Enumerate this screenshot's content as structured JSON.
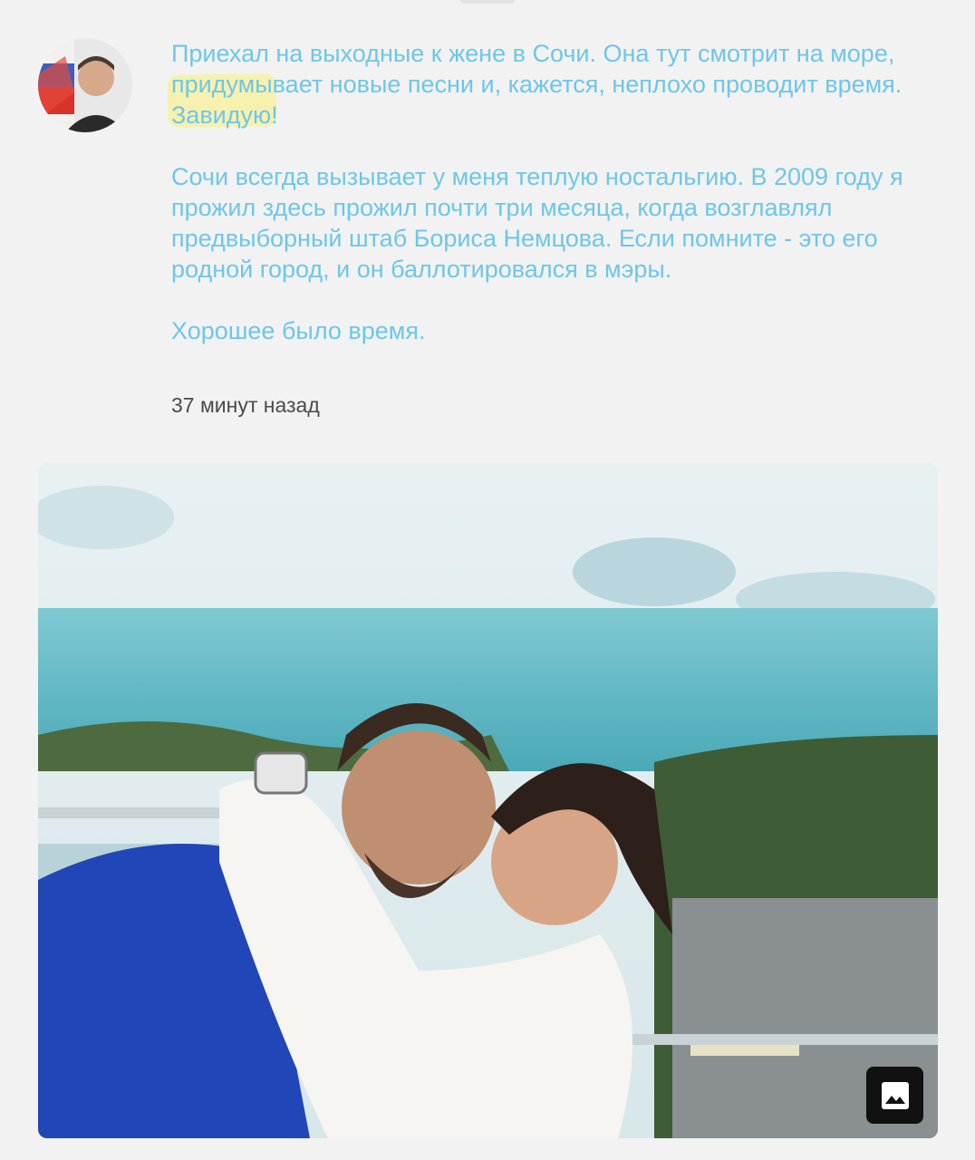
{
  "post": {
    "author_avatar": "avatar-icon",
    "paragraphs": {
      "p1_pre": "Приехал на выходные к жене в Сочи. Она тут смотрит на море, ",
      "p1_highlight": "придумывает новые песни и, кажется, неплохо проводит время. Завидую",
      "p1_post": "!",
      "p2": "Сочи всегда вызывает у меня теплую ностальгию. В 2009 году я прожил здесь прожил почти три месяца, когда возглавлял предвыборный штаб Бориса Немцова. Если помните - это его родной город, и он баллотировался в мэры.",
      "p3": "Хорошее было время."
    },
    "timestamp": "37 минут назад",
    "photo": {
      "gallery_icon": "image-gallery-icon"
    }
  },
  "colors": {
    "text_link": "#6ec6ea",
    "highlight": "#f7ef5a",
    "background": "#f2f2f2",
    "timestamp": "#4a4a4a"
  }
}
